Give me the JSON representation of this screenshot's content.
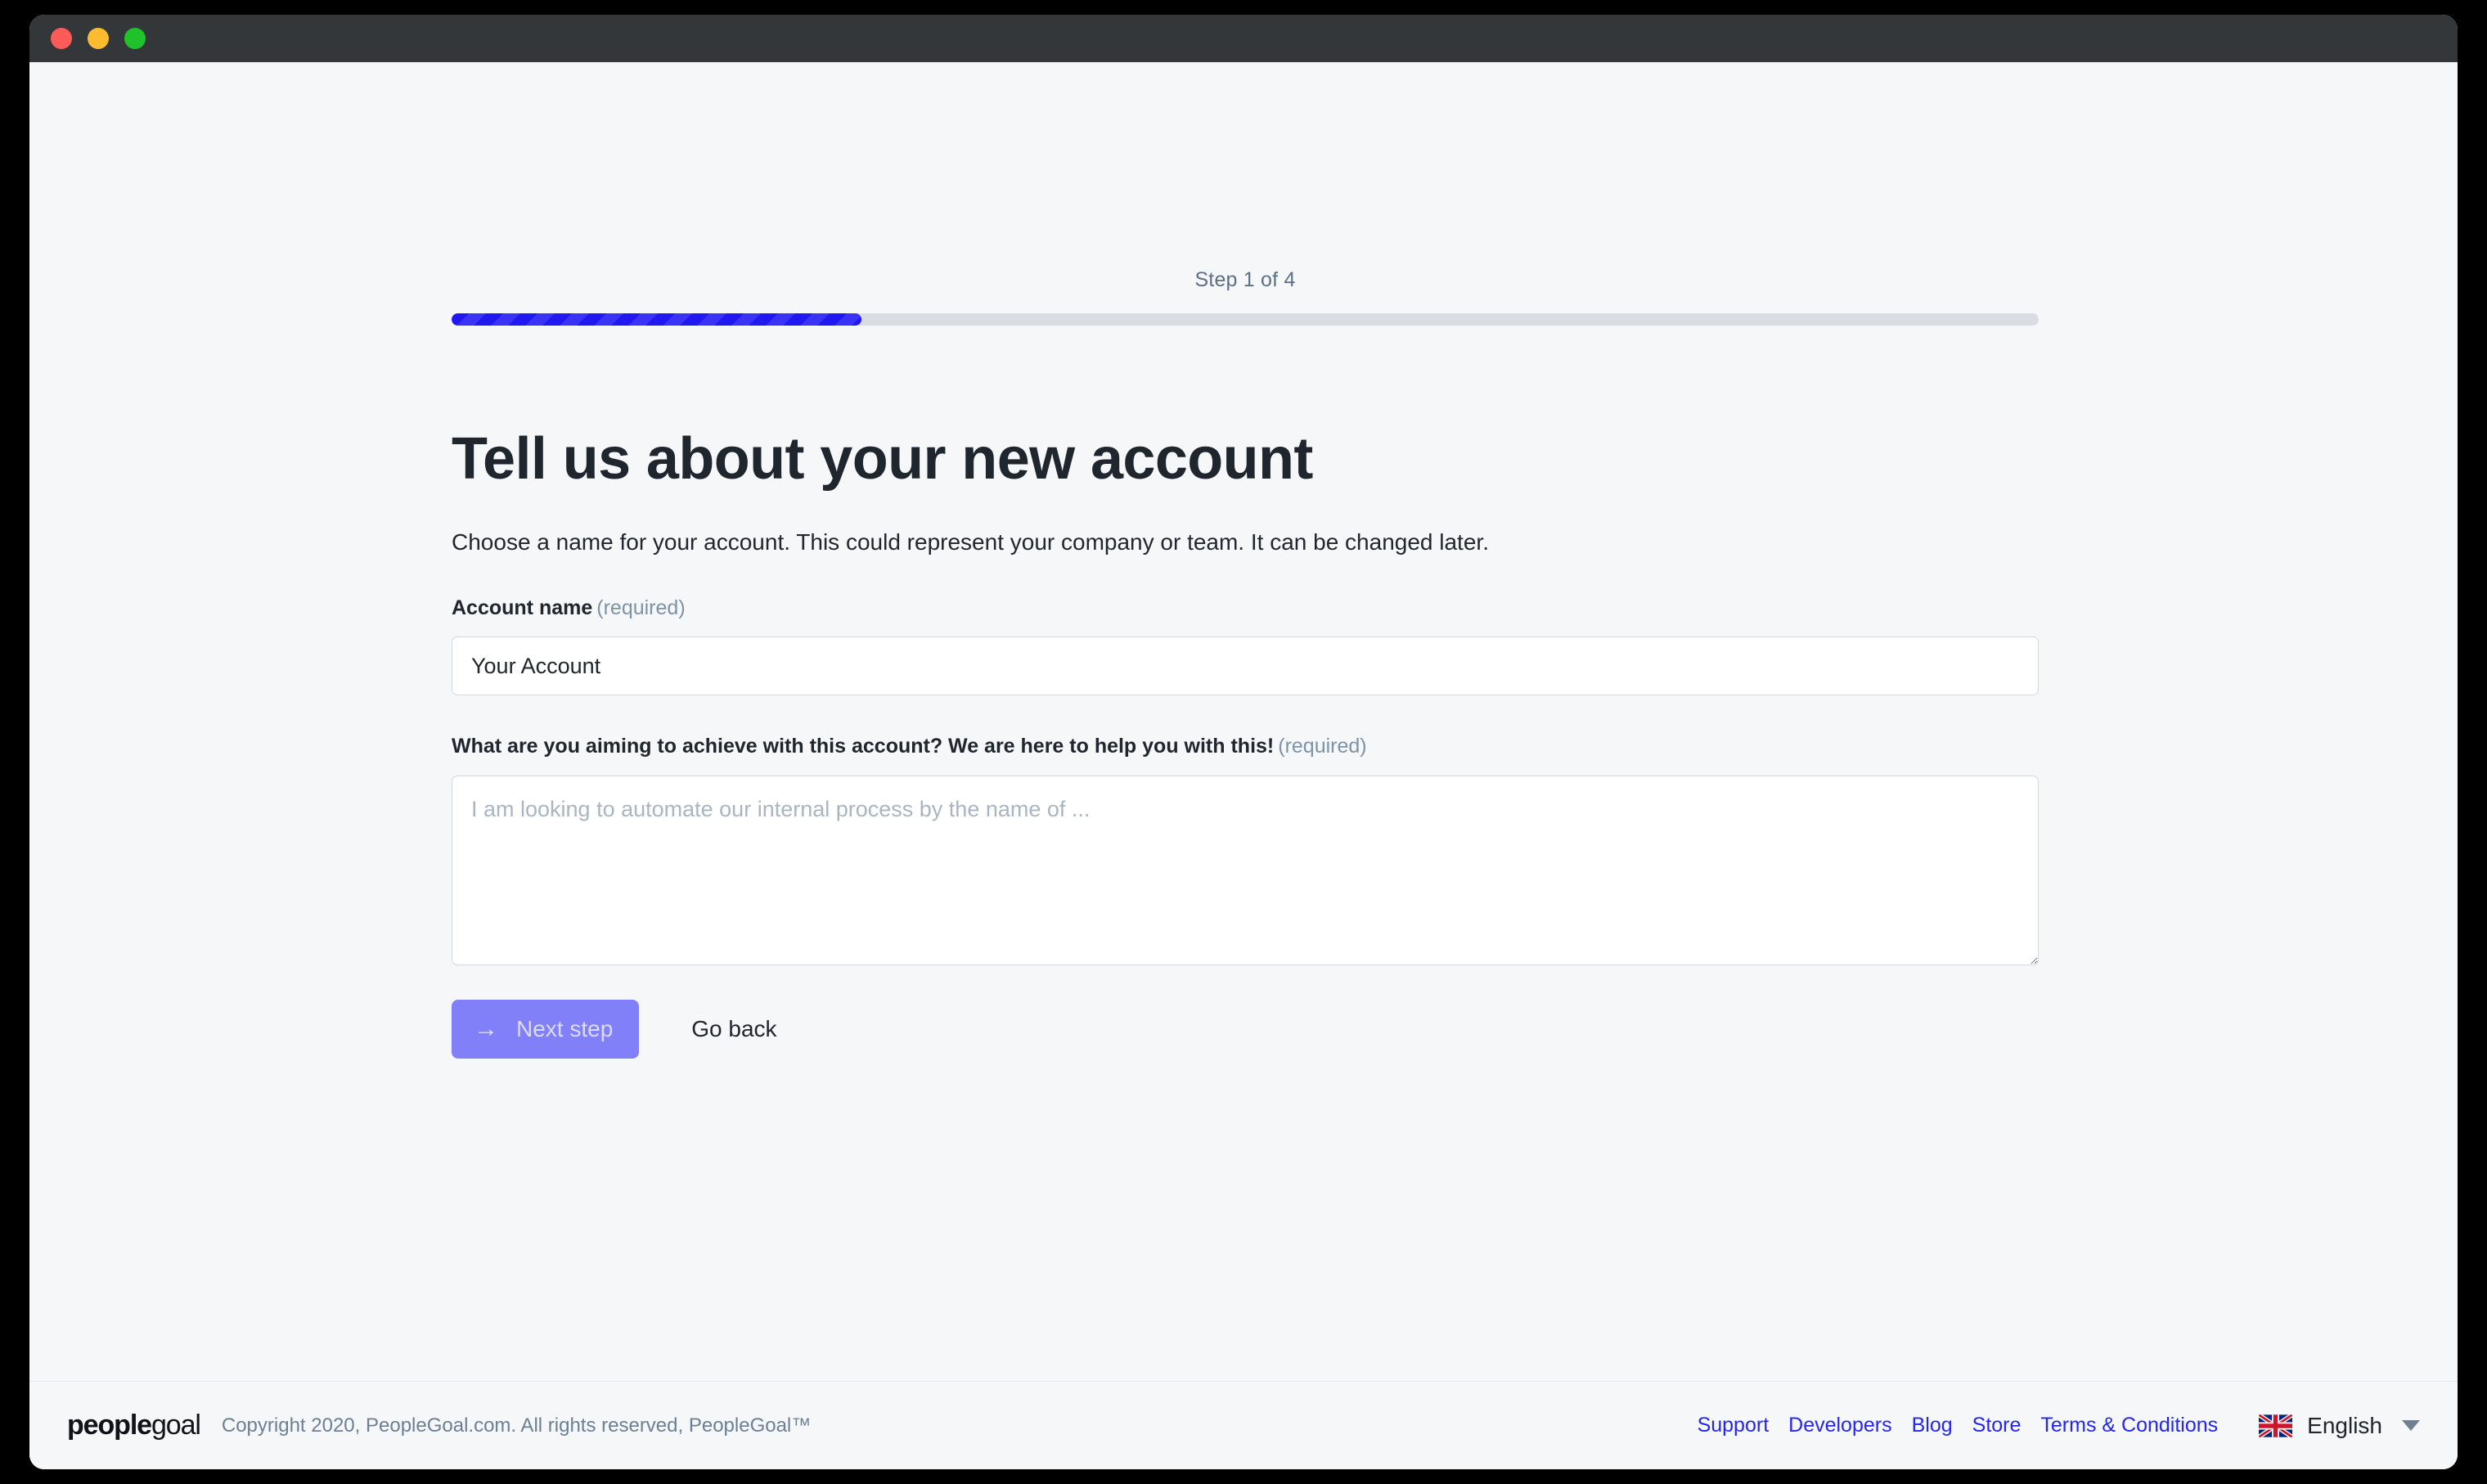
{
  "window": {
    "traffic_lights": [
      "close",
      "minimize",
      "maximize"
    ],
    "colors": {
      "close": "#fc5b57",
      "minimize": "#fdbc2f",
      "maximize": "#1fc22b",
      "titlebar": "#333739",
      "page_background": "#f5f7f9",
      "accent_progress": "#2018ef",
      "accent_progress_stripe": "#3a33f5",
      "primary_button": "#8280f8",
      "link_blue": "#2626ee",
      "muted_text": "#7d93a6"
    }
  },
  "progress": {
    "step_label": "Step 1 of 4",
    "current_step": 1,
    "total_steps": 4,
    "percent": 25.8
  },
  "main": {
    "title": "Tell us about your new account",
    "subtitle": "Choose a name for your account. This could represent your company or team. It can be changed later.",
    "account_name": {
      "label": "Account name",
      "required_tag": "(required)",
      "value": "Your Account",
      "placeholder": "Your Account"
    },
    "goal": {
      "label": "What are you aiming to achieve with this account? We are here to help you with this!",
      "required_tag": "(required)",
      "value": "",
      "placeholder": "I am looking to automate our internal process by the name of ..."
    },
    "next_button": {
      "label": "Next step",
      "icon": "arrow-right-icon",
      "arrow_glyph": "→",
      "disabled": true
    },
    "back_button": {
      "label": "Go back"
    }
  },
  "footer": {
    "brand_bold": "people",
    "brand_light": "goal",
    "copyright": "Copyright 2020, PeopleGoal.com. All rights reserved, PeopleGoal™",
    "links": [
      {
        "label": "Support"
      },
      {
        "label": "Developers"
      },
      {
        "label": "Blog"
      },
      {
        "label": "Store"
      },
      {
        "label": "Terms & Conditions"
      }
    ],
    "language": {
      "flag": "uk-flag-icon",
      "name": "English",
      "caret": "chevron-down-icon"
    }
  }
}
